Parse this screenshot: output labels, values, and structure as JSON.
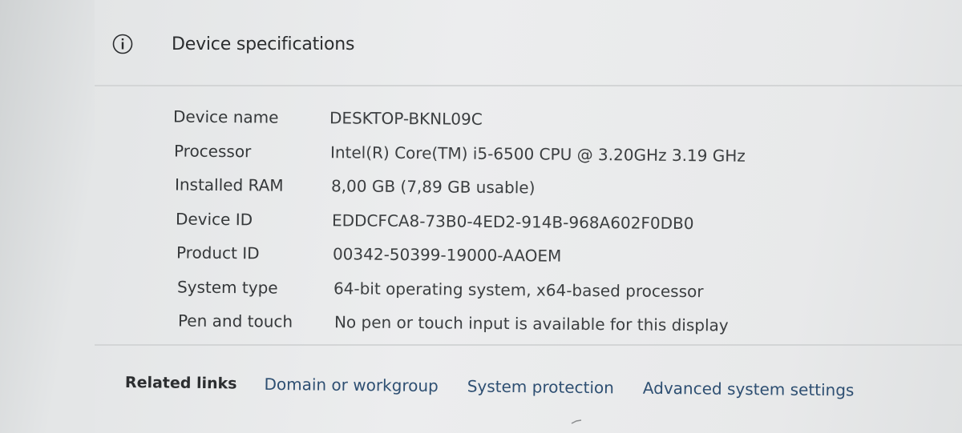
{
  "header": {
    "icon": "info-icon",
    "title": "Device specifications"
  },
  "specs": [
    {
      "label": "Device name",
      "value": "DESKTOP-BKNL09C"
    },
    {
      "label": "Processor",
      "value": "Intel(R) Core(TM) i5-6500 CPU @ 3.20GHz   3.19 GHz"
    },
    {
      "label": "Installed RAM",
      "value": "8,00 GB (7,89 GB usable)"
    },
    {
      "label": "Device ID",
      "value": "EDDCFCA8-73B0-4ED2-914B-968A602F0DB0"
    },
    {
      "label": "Product ID",
      "value": "00342-50399-19000-AAOEM"
    },
    {
      "label": "System type",
      "value": "64-bit operating system, x64-based processor"
    },
    {
      "label": "Pen and touch",
      "value": "No pen or touch input is available for this display"
    }
  ],
  "related": {
    "title": "Related links",
    "links": [
      "Domain or workgroup",
      "System protection",
      "Advanced system settings"
    ]
  },
  "colors": {
    "background": "#e8eaea",
    "text": "#35383a",
    "link": "#2e4f72"
  }
}
